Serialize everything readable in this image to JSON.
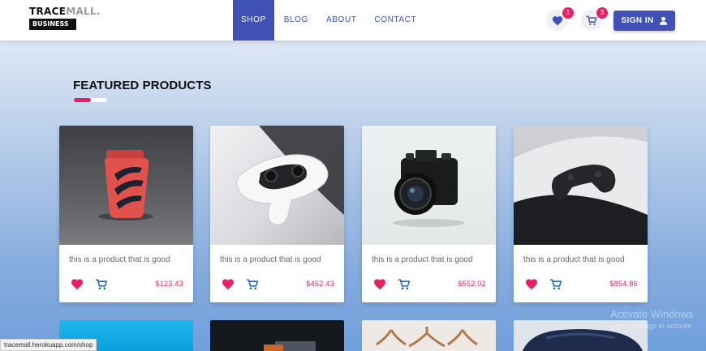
{
  "brand": {
    "name_main": "TRACE",
    "name_dim": "MALL.",
    "badge": "BUSINESS"
  },
  "nav": {
    "links": [
      "SHOP",
      "BLOG",
      "ABOUT",
      "CONTACT"
    ],
    "active": "SHOP"
  },
  "header_actions": {
    "wishlist": {
      "icon": "heart-icon",
      "count": "1"
    },
    "cart": {
      "icon": "cart-icon",
      "count": "3"
    },
    "signin_label": "SIGN IN",
    "signin_icon": "user-icon"
  },
  "colors": {
    "primary": "#3f51b5",
    "accent": "#e91e63",
    "price": "#e91e63",
    "cart_icon": "#1565c0"
  },
  "section": {
    "title": "FEATURED PRODUCTS"
  },
  "products": [
    {
      "image": "red-lighter",
      "description": "this is a product that is good",
      "price": "$123.43"
    },
    {
      "image": "game-controller",
      "description": "this is a product that is good",
      "price": "$452.43"
    },
    {
      "image": "camera",
      "description": "this is a product that is good",
      "price": "$552.02"
    },
    {
      "image": "game-console",
      "description": "this is a product that is good",
      "price": "$854.86"
    }
  ],
  "products_row2_images": [
    "blue-product",
    "dark-product",
    "hangers",
    "knit-sweater"
  ],
  "status_bar": {
    "url": "tracemall.herokuapp.com/shop"
  },
  "watermark": {
    "title": "Activate Windows",
    "subtitle": "Go to Settings to activate"
  }
}
